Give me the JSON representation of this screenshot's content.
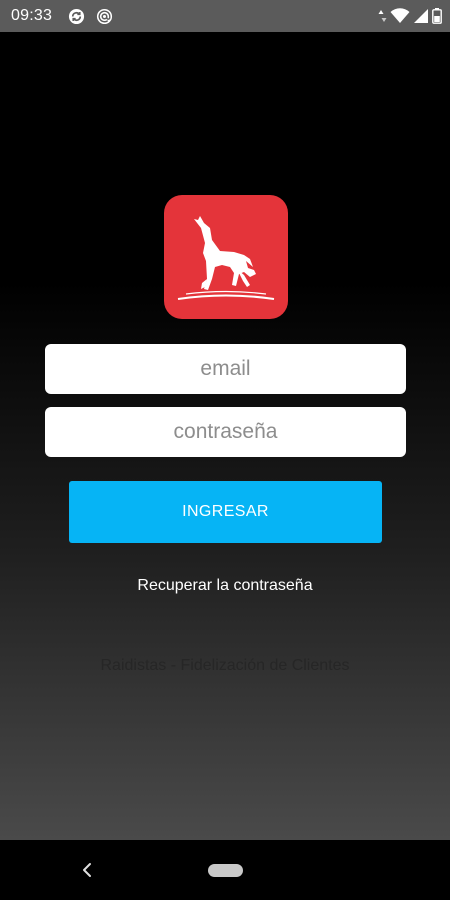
{
  "status_bar": {
    "time": "09:33",
    "icons": [
      "sync-notification-icon",
      "at-notification-icon",
      "data-arrows-icon",
      "wifi-icon",
      "signal-icon",
      "battery-icon"
    ]
  },
  "logo": {
    "icon": "horse-logo-icon",
    "color": "#e4343a"
  },
  "login_form": {
    "email_placeholder": "email",
    "password_placeholder": "contraseña",
    "submit_label": "INGRESAR",
    "recover_label": "Recuperar la contraseña"
  },
  "footer": {
    "text": "Raidistas - Fidelización de Clientes"
  },
  "nav_bar": {
    "icons": [
      "back-icon",
      "home-pill-icon"
    ]
  },
  "colors": {
    "accent": "#06b4f5",
    "brand_red": "#e4343a",
    "background": "#000000"
  }
}
